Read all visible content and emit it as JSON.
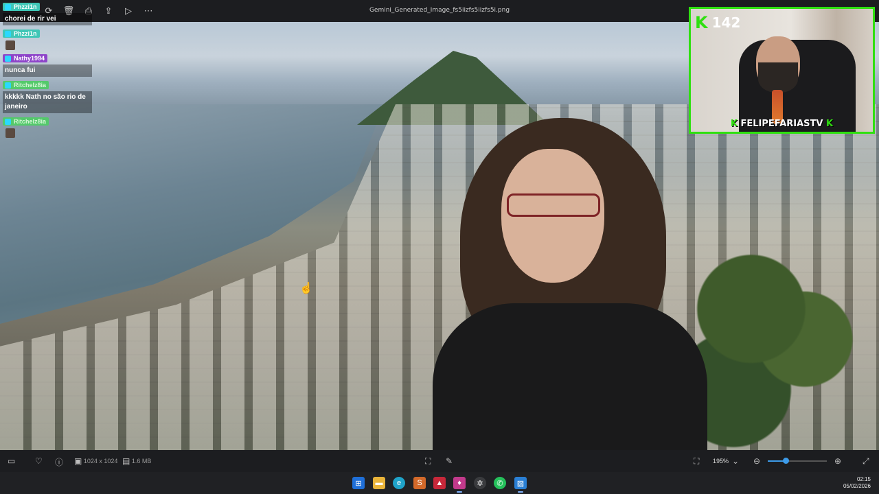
{
  "toolbar": {
    "file_title": "Gemini_Generated_Image_fs5iizfs5iizfs5i.png",
    "icons": [
      "rotate-icon",
      "delete-icon",
      "print-icon",
      "share-icon",
      "slideshow-icon",
      "more-icon"
    ]
  },
  "chat": {
    "messages": [
      {
        "user": "Phzzi1n",
        "text": "chorei de rir vei",
        "color": "#3fc6b6"
      },
      {
        "user": "Phzzi1n",
        "text": "",
        "color": "#3fc6b6"
      },
      {
        "user": "Nathy1994",
        "text": "nunca fui",
        "color": "#8e44c9"
      },
      {
        "user": "Ritchelz8ia",
        "text": "kkkkk Nath no são rio de janeiro",
        "color": "#54c96b"
      },
      {
        "user": "Ritchelz8ia",
        "text": "",
        "color": "#54c96b"
      }
    ]
  },
  "webcam": {
    "viewer_count": "142",
    "streamer_name": "FELIPEFARIASTV"
  },
  "bottombar": {
    "dimensions": "1024 x 1024",
    "file_size": "1.6 MB",
    "zoom": "195%",
    "zoom_fraction": 0.3
  },
  "taskbar": {
    "time": "02:15",
    "date": "05/02/2026",
    "apps": [
      "windows-start",
      "file-explorer",
      "edge",
      "sublime",
      "app-red",
      "app-purple",
      "chatgpt",
      "whatsapp",
      "photos"
    ]
  },
  "colors": {
    "kick_green": "#2fe010",
    "accent_blue": "#3d9be9"
  }
}
